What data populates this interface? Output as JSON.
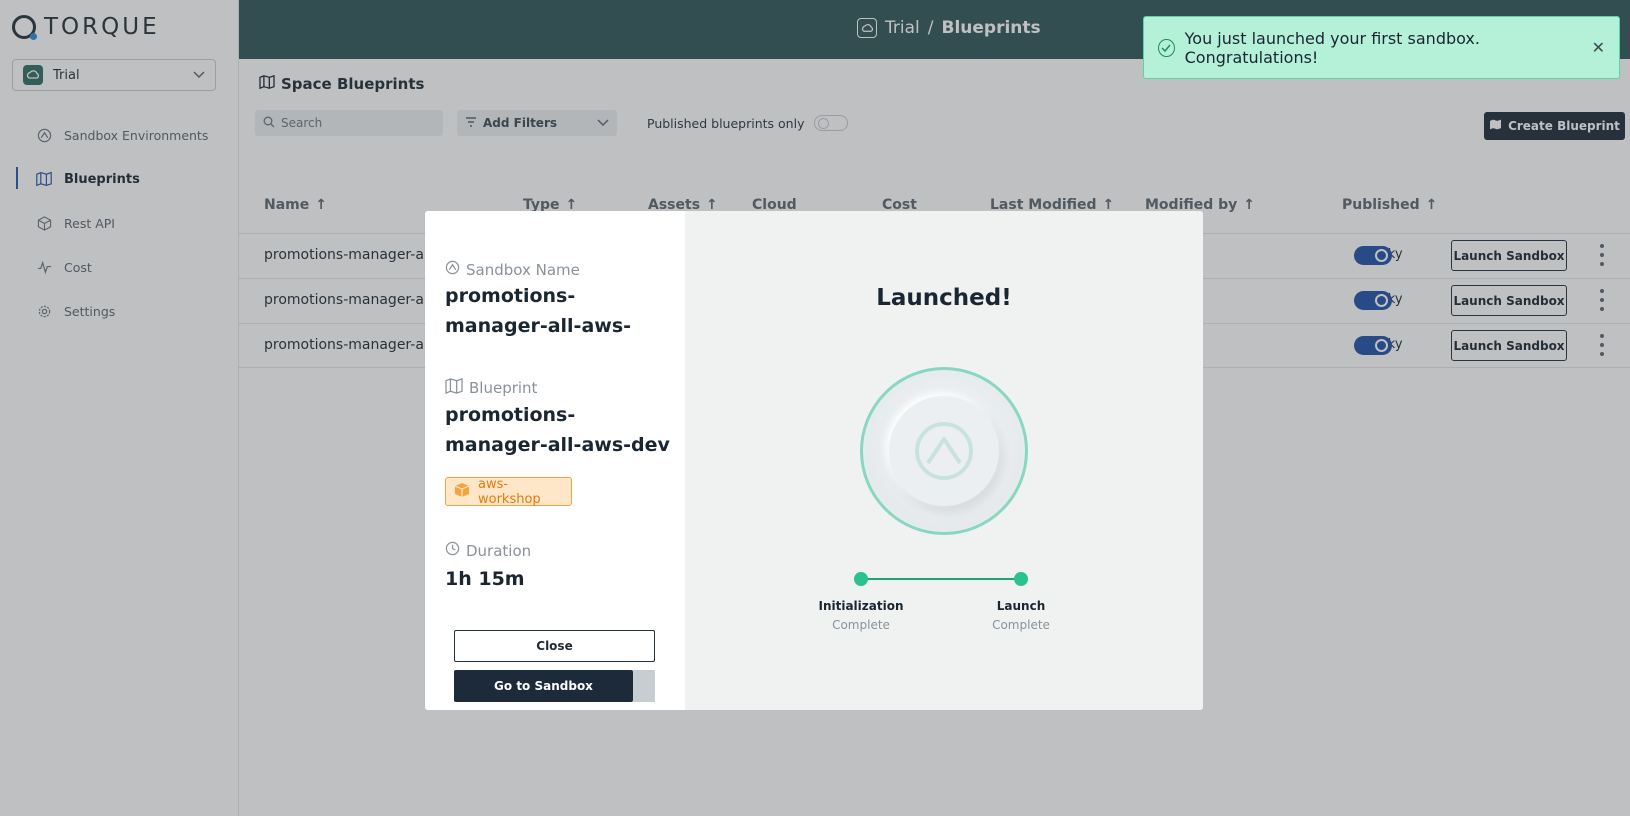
{
  "app": {
    "logo_text": "TORQUE"
  },
  "sidebar": {
    "space_name": "Trial",
    "items": [
      {
        "label": "Sandbox Environments",
        "icon": "sandbox-icon"
      },
      {
        "label": "Blueprints",
        "icon": "map-icon",
        "active": true
      },
      {
        "label": "Rest API",
        "icon": "cube-icon"
      },
      {
        "label": "Cost",
        "icon": "pulse-icon"
      },
      {
        "label": "Settings",
        "icon": "gear-icon"
      }
    ]
  },
  "header": {
    "space": "Trial",
    "separator": "/",
    "page": "Blueprints"
  },
  "toast": {
    "message": "You just launched your first sandbox. Congratulations!"
  },
  "main": {
    "title": "Space Blueprints",
    "search_placeholder": "Search",
    "filters_label": "Add Filters",
    "published_only_label": "Published blueprints only",
    "create_button": "Create Blueprint",
    "columns": {
      "name": "Name",
      "type": "Type",
      "assets": "Assets",
      "cloud": "Cloud",
      "cost": "Cost",
      "last_modified": "Last Modified",
      "modified_by": "Modified by",
      "published": "Published"
    },
    "rows": [
      {
        "name": "promotions-manager-all-",
        "modified_by": "sky",
        "launch": "Launch Sandbox"
      },
      {
        "name": "promotions-manager-all-",
        "modified_by": "sky",
        "launch": "Launch Sandbox"
      },
      {
        "name": "promotions-manager-all-",
        "modified_by": "sky",
        "launch": "Launch Sandbox"
      }
    ]
  },
  "modal": {
    "sandbox_name_label": "Sandbox Name",
    "sandbox_name": "promotions-manager-all-aws-",
    "blueprint_label": "Blueprint",
    "blueprint_name": "promotions-manager-all-aws-dev",
    "repo_tag": "aws-workshop",
    "duration_label": "Duration",
    "duration": "1h 15m",
    "close_button": "Close",
    "go_button": "Go to Sandbox",
    "status_title": "Launched!",
    "steps": [
      {
        "label": "Initialization",
        "status": "Complete"
      },
      {
        "label": "Launch",
        "status": "Complete"
      }
    ]
  },
  "colors": {
    "header_bg": "#2f5557",
    "accent_green": "#2cc28e",
    "toast_bg": "#b5f0d8",
    "primary_dark": "#1c2a3a",
    "tag_orange": "#f5a340"
  }
}
